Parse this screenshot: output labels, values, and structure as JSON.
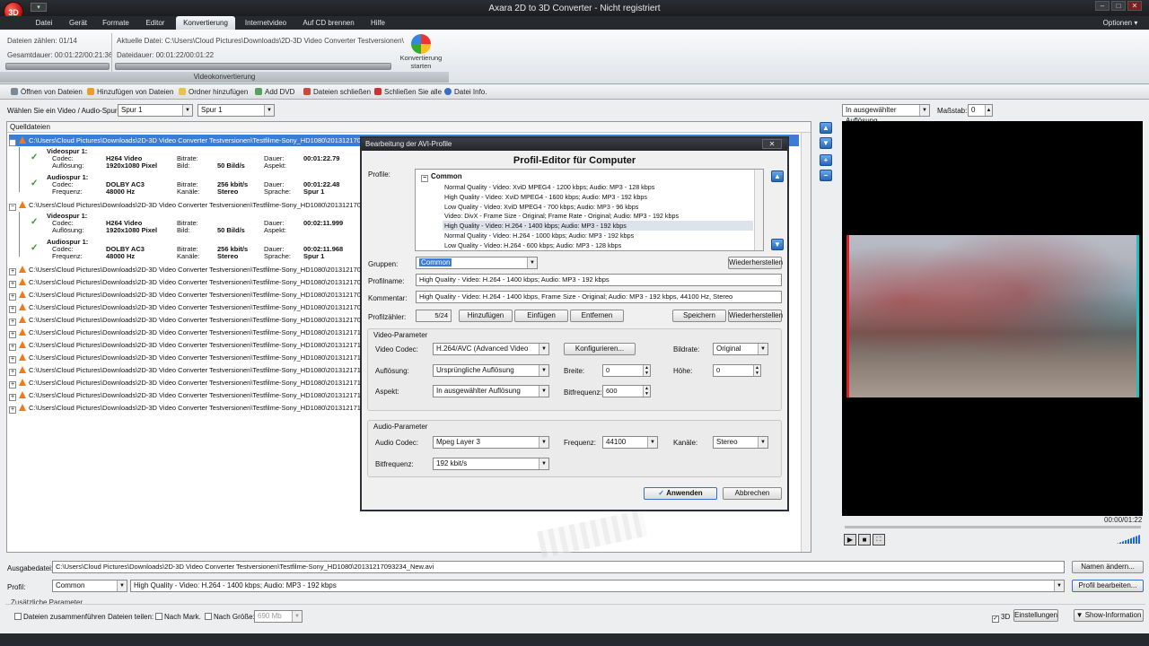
{
  "window": {
    "title": "Axara 2D to 3D Converter - Nicht registriert",
    "logo_text": "3D",
    "options_label": "Optionen",
    "controls": [
      "–",
      "□",
      "✕"
    ]
  },
  "menu": [
    "Datei",
    "Gerät",
    "Formate",
    "Editor",
    "Konvertierung",
    "Internetvideo",
    "Auf CD brennen",
    "Hilfe"
  ],
  "ribbon": {
    "files_count": "Dateien zählen: 01/14",
    "total_duration": "Gesamtdauer: 00:01:22/00:21:36",
    "current_file": "Aktuelle Datei: C:\\Users\\Cloud Pictures\\Downloads\\2D-3D Video Converter Testversionen\\",
    "file_duration": "Dateidauer: 00:01:22/00:01:22",
    "convert_l1": "Konvertierung",
    "convert_l2": "starten",
    "group_label": "Videokonvertierung"
  },
  "toolbar": [
    "Öffnen von Dateien",
    "Hinzufügen von Dateien",
    "Ordner hinzufügen",
    "Add DVD",
    "Dateien schließen",
    "Schließen Sie alle",
    "Datei Info."
  ],
  "track_label": "Wählen Sie ein Video / Audio-Spur:",
  "track_video": "Spur 1",
  "track_audio": "Spur 1",
  "source_header": "Quelldateien",
  "files": [
    "C:\\Users\\Cloud Pictures\\Downloads\\2D-3D Video Converter Testversionen\\Testfilme-Sony_HD1080\\20131217093234.m2ts",
    "C:\\Users\\Cloud Pictures\\Downloads\\2D-3D Video Converter Testversionen\\Testfilme-Sony_HD1080\\20131217093933.m2ts",
    "C:\\Users\\Cloud Pictures\\Downloads\\2D-3D Video Converter Testversionen\\Testfilme-Sony_HD1080\\20131217094221",
    "C:\\Users\\Cloud Pictures\\Downloads\\2D-3D Video Converter Testversionen\\Testfilme-Sony_HD1080\\20131217094411",
    "C:\\Users\\Cloud Pictures\\Downloads\\2D-3D Video Converter Testversionen\\Testfilme-Sony_HD1080\\20131217095210",
    "C:\\Users\\Cloud Pictures\\Downloads\\2D-3D Video Converter Testversionen\\Testfilme-Sony_HD1080\\20131217095543",
    "C:\\Users\\Cloud Pictures\\Downloads\\2D-3D Video Converter Testversionen\\Testfilme-Sony_HD1080\\20131217095812",
    "C:\\Users\\Cloud Pictures\\Downloads\\2D-3D Video Converter Testversionen\\Testfilme-Sony_HD1080\\20131217100102",
    "C:\\Users\\Cloud Pictures\\Downloads\\2D-3D Video Converter Testversionen\\Testfilme-Sony_HD1080\\20131217100350",
    "C:\\Users\\Cloud Pictures\\Downloads\\2D-3D Video Converter Testversionen\\Testfilme-Sony_HD1080\\20131217100512",
    "C:\\Users\\Cloud Pictures\\Downloads\\2D-3D Video Converter Testversionen\\Testfilme-Sony_HD1080\\20131217100944",
    "C:\\Users\\Cloud Pictures\\Downloads\\2D-3D Video Converter Testversionen\\Testfilme-Sony_HD1080\\20131217101218",
    "C:\\Users\\Cloud Pictures\\Downloads\\2D-3D Video Converter Testversionen\\Testfilme-Sony_HD1080\\20131217101833",
    "C:\\Users\\Cloud Pictures\\Downloads\\2D-3D Video Converter Testversionen\\Testfilme-Sony_HD1080\\20131217102015"
  ],
  "details": [
    {
      "vtitle": "Videospur 1:",
      "vcodec": "H264 Video",
      "vres": "1920x1080 Pixel",
      "vbit": "",
      "vfps": "50 Bild/s",
      "vdur": "00:01:22.79",
      "vasp": "",
      "atitle": "Audiospur 1:",
      "acodec": "DOLBY AC3",
      "afreq": "48000 Hz",
      "abit": "256 kbit/s",
      "ach": "Stereo",
      "adur": "00:01:22.48",
      "alang": "Spur 1"
    },
    {
      "vtitle": "Videospur 1:",
      "vcodec": "H264 Video",
      "vres": "1920x1080 Pixel",
      "vbit": "",
      "vfps": "50 Bild/s",
      "vdur": "00:02:11.999",
      "vasp": "",
      "atitle": "Audiospur 1:",
      "acodec": "DOLBY AC3",
      "afreq": "48000 Hz",
      "abit": "256 kbit/s",
      "ach": "Stereo",
      "adur": "00:02:11.968",
      "alang": "Spur 1"
    }
  ],
  "dlabels": {
    "codec": "Codec:",
    "res": "Auflösung:",
    "bit": "Bitrate:",
    "fps": "Bild:",
    "dur": "Dauer:",
    "asp": "Aspekt:",
    "freq": "Frequenz:",
    "ch": "Kanäle:",
    "lang": "Sprache:"
  },
  "dialog": {
    "title": "Bearbeitung der AVI-Profile",
    "heading": "Profil-Editor für Computer",
    "profiles_label": "Profile:",
    "tree_root": "Common",
    "profiles": [
      "Normal Quality - Video: XviD MPEG4 - 1200 kbps; Audio: MP3 - 128 kbps",
      "High Quality - Video: XviD MPEG4 - 1600 kbps; Audio: MP3 - 192 kbps",
      "Low Quality - Video: XviD MPEG4 - 700 kbps; Audio: MP3 - 96 kbps",
      "Video: DivX - Frame Size - Original; Frame Rate - Original; Audio: MP3 - 192 kbps",
      "High Quality - Video: H.264 - 1400 kbps; Audio: MP3 - 192 kbps",
      "Normal Quality - Video: H.264 - 1000 kbps; Audio: MP3 - 192 kbps",
      "Low Quality - Video: H.264 - 600 kbps; Audio: MP3 - 128 kbps"
    ],
    "groups_label": "Gruppen:",
    "group_value": "Common",
    "restore": "Wiederherstellen",
    "name_label": "Profilname:",
    "name_value": "High Quality - Video: H.264 - 1400 kbps; Audio: MP3 - 192 kbps",
    "comment_label": "Kommentar:",
    "comment_value": "High Quality - Video: H.264 - 1400 kbps, Frame Size - Original;  Audio: MP3 - 192 kbps, 44100 Hz, Stereo",
    "counter_label": "Profilzähler:",
    "counter_value": "5/24",
    "add": "Hinzufügen",
    "paste": "Einfügen",
    "remove": "Entfernen",
    "save": "Speichern",
    "restore2": "Wiederherstellen",
    "video_group": "Video-Parameter",
    "vcodec_label": "Video Codec:",
    "vcodec": "H.264/AVC (Advanced Video Coding)",
    "configure": "Konfigurieren...",
    "bitrate_label": "Bildrate:",
    "bitrate": "Original",
    "res_label": "Auflösung:",
    "res": "Ursprüngliche Auflösung",
    "width_label": "Breite:",
    "width": "0",
    "height_label": "Höhe:",
    "height": "0",
    "aspect_label": "Aspekt:",
    "aspect": "In ausgewählter Auflösung schreiben",
    "bitfreq_label": "Bitfrequenz:",
    "bitfreq": "600",
    "audio_group": "Audio-Parameter",
    "acodec_label": "Audio Codec:",
    "acodec": "Mpeg Layer 3",
    "freq_label": "Frequenz:",
    "freq": "44100",
    "ch_label": "Kanäle:",
    "ch": "Stereo",
    "abit_label": "Bitfrequenz:",
    "abit": "192 kbit/s",
    "apply": "Anwenden",
    "cancel": "Abbrechen"
  },
  "preview": {
    "mode": "In ausgewählter Auflösung",
    "scale_label": "Maßstab:",
    "scale": "0",
    "time": "00:00/01:22"
  },
  "bottom": {
    "out_label": "Ausgabedatei:",
    "out_path": "C:\\Users\\Cloud Pictures\\Downloads\\2D-3D Video Converter Testversionen\\Testfilme-Sony_HD1080\\20131217093234_New.avi",
    "rename": "Namen ändern...",
    "profile_label": "Profil:",
    "profile_group": "Common",
    "profile_value": "High Quality - Video: H.264 - 1400 kbps; Audio: MP3 - 192 kbps",
    "edit_profile": "Profil bearbeiten...",
    "extra": "Zusätzliche Parameter",
    "merge": "Dateien zusammenführen",
    "split": "Dateien teilen:",
    "by_mark": "Nach Mark.",
    "by_size": "Nach Größe:",
    "size": "690 Mb",
    "d3": "3D",
    "settings": "Einstellungen",
    "show_info": "Show-Information"
  },
  "colors": {
    "accent": "#3470c8",
    "selection": "#3b7cd8",
    "titlebar": "#1f2226"
  }
}
